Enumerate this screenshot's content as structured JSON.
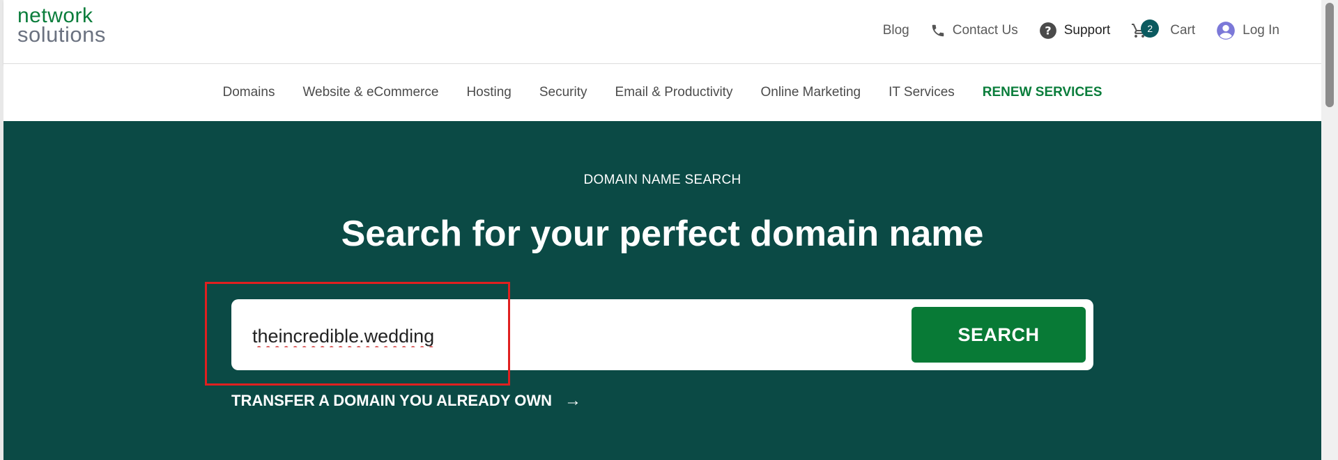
{
  "brand": {
    "line1": "network",
    "line2": "solutions"
  },
  "top_links": {
    "blog": "Blog",
    "contact": "Contact Us",
    "support": "Support",
    "cart": "Cart",
    "cart_count": "2",
    "login": "Log In"
  },
  "nav": {
    "items": [
      "Domains",
      "Website & eCommerce",
      "Hosting",
      "Security",
      "Email & Productivity",
      "Online Marketing",
      "IT Services",
      "RENEW SERVICES"
    ]
  },
  "hero": {
    "eyebrow": "DOMAIN NAME SEARCH",
    "title": "Search for your perfect domain name",
    "search_value": "theincredible.wedding",
    "search_button": "SEARCH",
    "transfer_text": "TRANSFER A DOMAIN YOU ALREADY OWN",
    "transfer_arrow": "→"
  },
  "colors": {
    "brand_green": "#0a7d3b",
    "hero_bg": "#0b4a45",
    "button_green": "#087a36",
    "cart_badge": "#0b5a5f",
    "highlight_red": "#e02020"
  },
  "icons": {
    "phone": "phone-icon",
    "support": "help-circle-icon",
    "cart": "cart-icon",
    "user": "user-circle-icon",
    "arrow": "arrow-right-icon"
  }
}
